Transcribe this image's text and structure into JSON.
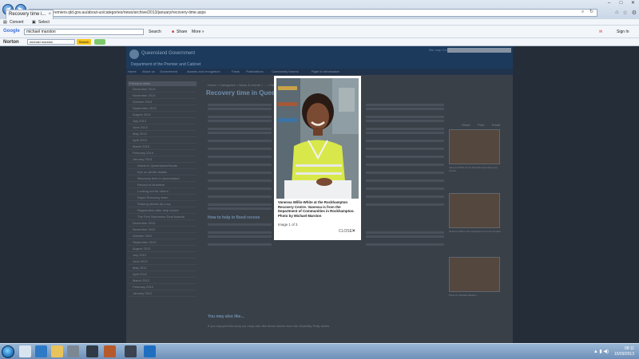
{
  "browser": {
    "url": "http://www.premiers.qld.gov.au/about-us/categories/news/archive/2013/january/recovery-time.aspx",
    "tab_title": "Recovery time i...",
    "tab_close": "×",
    "menu": {
      "convert": "Convert",
      "select": "Select"
    },
    "google": {
      "label": "Google",
      "query": "michael marston",
      "search_btn": "Search",
      "share": "Share",
      "more": "More »",
      "sign_in": "Sign In"
    },
    "norton": {
      "label": "Norton",
      "query": "michael marston",
      "search_btn": "Search"
    }
  },
  "site": {
    "org": "Queensland Government",
    "dept": "Department of the Premier and Cabinet",
    "utility": "Site map   Contact us   Help",
    "search_btn": "Search",
    "nav": [
      "Home",
      "About us",
      "Government",
      "Awards and recognition",
      "Facts",
      "Publications",
      "Community forums",
      "Right to Information"
    ],
    "breadcrumb": "Home > Categories > News & events > ... > Recovery time in Queensland",
    "article_title": "Recovery time in Queens",
    "section_help": "How to help in flood recove",
    "section_also": "You may also like...",
    "also_text": "If you enjoyed this story you may also like these stories from the Disability Rally series",
    "share": [
      "Share",
      "Print",
      "Email"
    ],
    "sidebar_title": "Previous news",
    "sidebar": [
      "December 2013",
      "November 2013",
      "October 2013",
      "September 2013",
      "August 2013",
      "July 2013",
      "June 2013",
      "May 2013",
      "April 2013",
      "March 2013",
      "February 2013",
      "January 2013",
      "Article in Queensland floods",
      "Eye on all the details",
      "Recovery time in Queensland",
      "Record of kindness",
      "Looking out for others",
      "Rapid Recovery team",
      "Sharing stories by Lucy",
      "Registration after help closes",
      "The First Swimmers Deal Awards",
      "December 2012",
      "November 2012",
      "October 2012",
      "September 2012",
      "August 2012",
      "July 2012",
      "June 2012",
      "May 2012",
      "April 2012",
      "March 2012",
      "February 2012",
      "January 2012"
    ],
    "thumb_labels": [
      "Vanessa White at the Rockhampton Recovery Centre",
      "Rebecca Mills in the Department of Communities",
      "Photo by Michael Marston"
    ]
  },
  "lightbox": {
    "caption": "Vanessa Willis-White at the Rockhampton Recovery Centre. Vanessa is from the Department of Communities in Rockhampton. Photo by Michael Marston",
    "pager": "Image 1 of 3",
    "close_label": "CLOSE",
    "close_icon": "×"
  },
  "taskbar": {
    "time": "08:11",
    "date": "15/09/2013"
  },
  "colors": {
    "lightbox_bg": "#ffffff",
    "overlay": "#252d38",
    "vest": "#d8e84a"
  }
}
